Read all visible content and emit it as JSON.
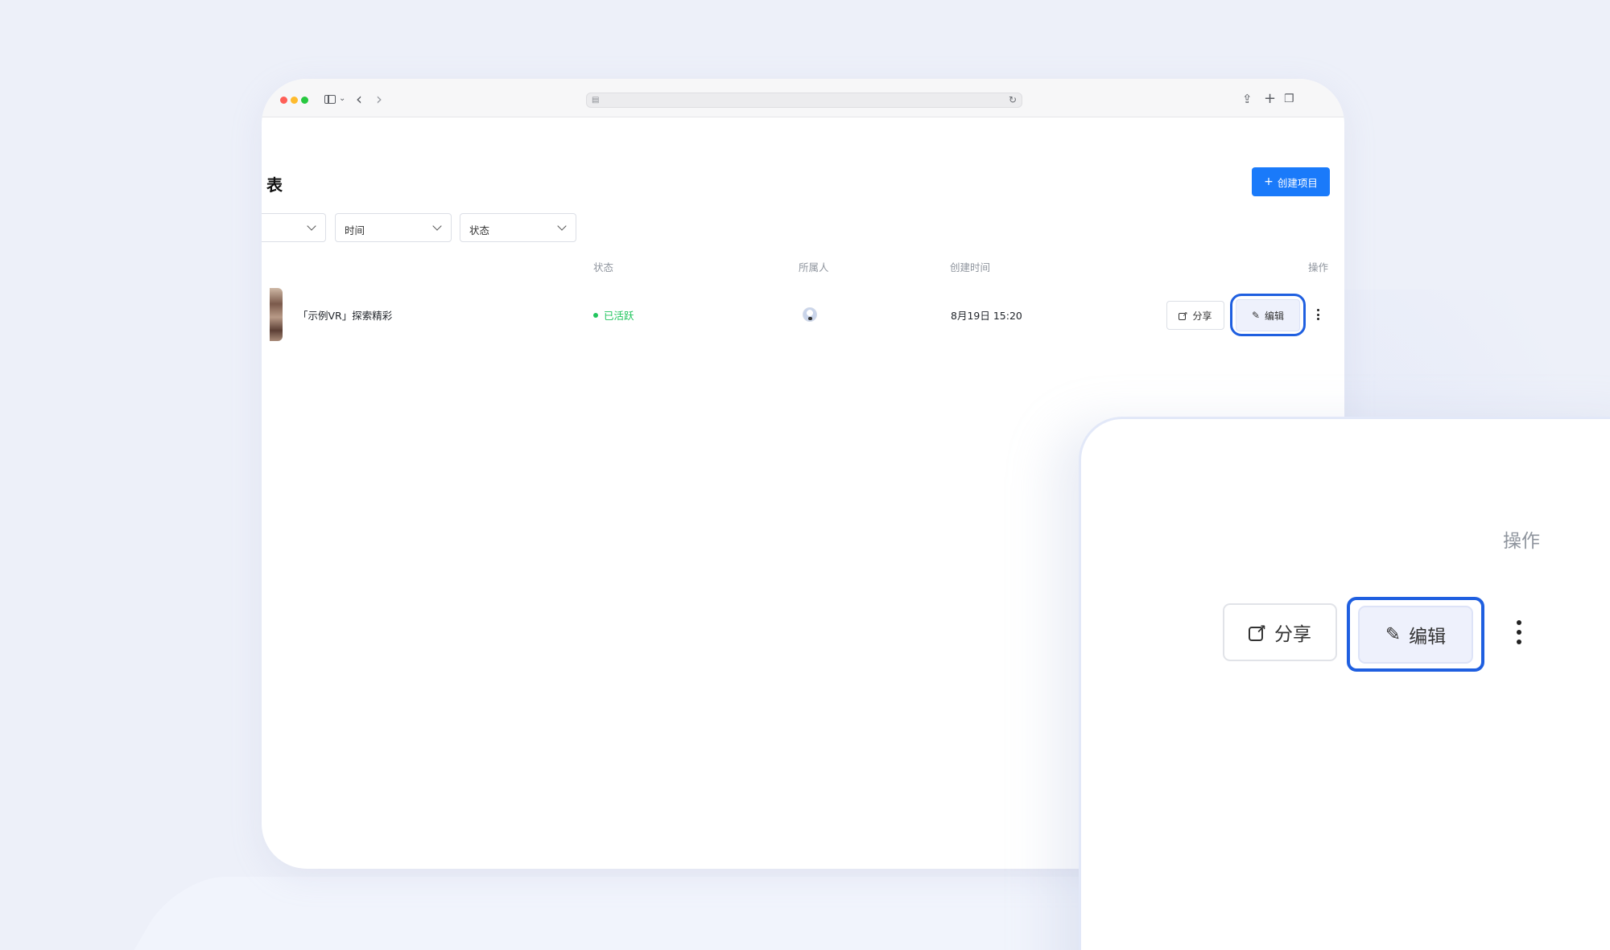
{
  "browser": {
    "address": ""
  },
  "page": {
    "title_fragment": "表",
    "create_button": "创建项目",
    "create_plus": "+",
    "filters": {
      "first": "",
      "time": "时间",
      "status": "状态"
    },
    "table": {
      "headers": {
        "status": "状态",
        "owner": "所属人",
        "created": "创建时间",
        "actions": "操作"
      },
      "rows": [
        {
          "name": "「示例VR」探索精彩",
          "status": "已活跃",
          "created": "8月19日 15:20",
          "share": "分享",
          "edit": "编辑"
        }
      ]
    }
  },
  "zoom": {
    "actions_header": "操作",
    "share": "分享",
    "edit": "编辑"
  },
  "colors": {
    "accent": "#1a7afa",
    "highlight_ring": "#1f5fe0",
    "status_active": "#22c55e",
    "background": "#edf0f9"
  },
  "icons": {
    "share": "external-link-icon",
    "edit": "pen-icon",
    "more": "kebab-menu-icon"
  }
}
